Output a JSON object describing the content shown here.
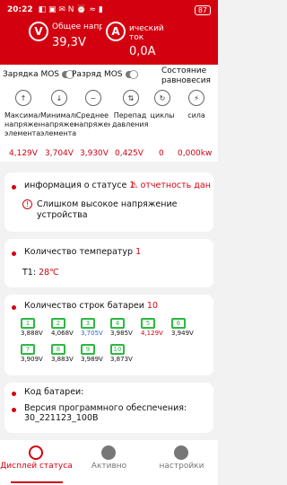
{
  "status_bar": {
    "time": "20:22",
    "icons": "◧ ▣ ✉ N ⏰ ≈ ▮",
    "battery": "87"
  },
  "header": {
    "voltage": {
      "label": "Общее напряжение",
      "value": "39,3V",
      "icon": "voltage-icon"
    },
    "current": {
      "label": "ический ток",
      "value": "0,0A",
      "icon": "current-icon"
    }
  },
  "mos": {
    "charge_label": "Зарядка MOS",
    "discharge_label": "Разряд MOS",
    "equilibrium_label": "Состояние равновесия"
  },
  "metrics": [
    {
      "icon": "max-cell-icon",
      "label": "Максимальное напряжение элемента",
      "value": "4,129V"
    },
    {
      "icon": "min-cell-icon",
      "label": "Минимальное напряжение элемента",
      "value": "3,704V"
    },
    {
      "icon": "avg-voltage-icon",
      "label": "Среднее напряжение",
      "value": "3,930V"
    },
    {
      "icon": "pressure-diff-icon",
      "label": "Перепад давления",
      "value": "0,425V"
    },
    {
      "icon": "cycles-icon",
      "label": "циклы",
      "value": "0"
    },
    {
      "icon": "power-icon",
      "label": "сила",
      "value": "0,000kw"
    }
  ],
  "status_card": {
    "title": "информация о статусе",
    "count": "1",
    "report": "отчетность дан",
    "message": "Слишком высокое напряжение устройства"
  },
  "temp_card": {
    "title": "Количество температур",
    "count": "1",
    "sensor": "T1:",
    "value": "28℃"
  },
  "cells_card": {
    "title": "Количество строк батареи",
    "count": "10",
    "cells": [
      {
        "n": "1",
        "v": "3,888V",
        "color": "#111111"
      },
      {
        "n": "2",
        "v": "4,068V",
        "color": "#111111"
      },
      {
        "n": "3",
        "v": "3,705V",
        "color": "#1e64c8"
      },
      {
        "n": "4",
        "v": "3,985V",
        "color": "#111111"
      },
      {
        "n": "5",
        "v": "4,129V",
        "color": "#d30010"
      },
      {
        "n": "6",
        "v": "3,949V",
        "color": "#111111"
      },
      {
        "n": "7",
        "v": "3,909V",
        "color": "#111111"
      },
      {
        "n": "8",
        "v": "3,883V",
        "color": "#111111"
      },
      {
        "n": "9",
        "v": "3,989V",
        "color": "#111111"
      },
      {
        "n": "10",
        "v": "3,873V",
        "color": "#111111"
      }
    ]
  },
  "battery_card": {
    "code_label": "Код батареи:",
    "firmware": "Версия программного обеспечения: 30_221123_100B"
  },
  "nav": {
    "items": [
      "Дисплей статуса",
      "Активно",
      "настройки"
    ]
  },
  "colors": {
    "accent": "#d30010",
    "cell_green": "#2cb940"
  }
}
